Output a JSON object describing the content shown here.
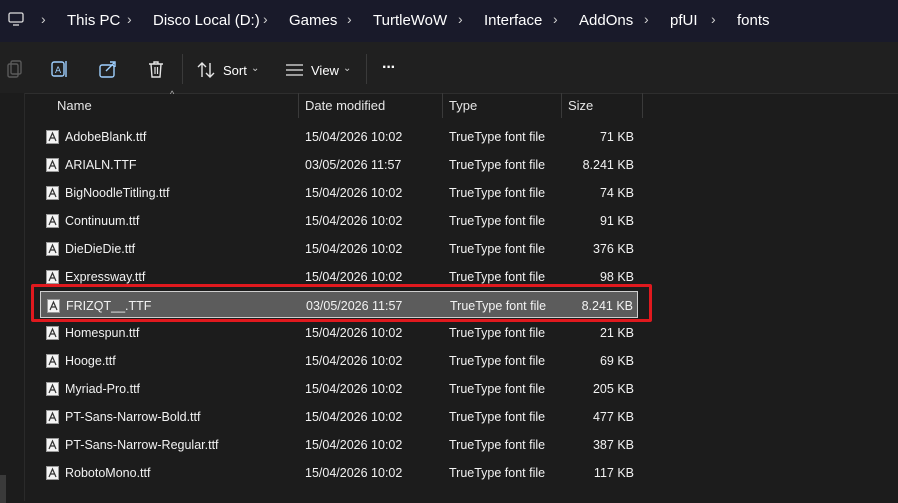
{
  "breadcrumb": [
    "This PC",
    "Disco Local (D:)",
    "Games",
    "TurtleWoW",
    "Interface",
    "AddOns",
    "pfUI",
    "fonts"
  ],
  "toolbar": {
    "sort_label": "Sort",
    "view_label": "View",
    "more_label": "···"
  },
  "columns": {
    "name": "Name",
    "date": "Date modified",
    "type": "Type",
    "size": "Size"
  },
  "files": [
    {
      "name": "AdobeBlank.ttf",
      "date": "15/04/2026 10:02",
      "type": "TrueType font file",
      "size": "71 KB"
    },
    {
      "name": "ARIALN.TTF",
      "date": "03/05/2026 11:57",
      "type": "TrueType font file",
      "size": "8.241 KB"
    },
    {
      "name": "BigNoodleTitling.ttf",
      "date": "15/04/2026 10:02",
      "type": "TrueType font file",
      "size": "74 KB"
    },
    {
      "name": "Continuum.ttf",
      "date": "15/04/2026 10:02",
      "type": "TrueType font file",
      "size": "91 KB"
    },
    {
      "name": "DieDieDie.ttf",
      "date": "15/04/2026 10:02",
      "type": "TrueType font file",
      "size": "376 KB"
    },
    {
      "name": "Expressway.ttf",
      "date": "15/04/2026 10:02",
      "type": "TrueType font file",
      "size": "98 KB"
    },
    {
      "name": "FRIZQT__.TTF",
      "date": "03/05/2026 11:57",
      "type": "TrueType font file",
      "size": "8.241 KB",
      "selected": true
    },
    {
      "name": "Homespun.ttf",
      "date": "15/04/2026 10:02",
      "type": "TrueType font file",
      "size": "21 KB"
    },
    {
      "name": "Hooge.ttf",
      "date": "15/04/2026 10:02",
      "type": "TrueType font file",
      "size": "69 KB"
    },
    {
      "name": "Myriad-Pro.ttf",
      "date": "15/04/2026 10:02",
      "type": "TrueType font file",
      "size": "205 KB"
    },
    {
      "name": "PT-Sans-Narrow-Bold.ttf",
      "date": "15/04/2026 10:02",
      "type": "TrueType font file",
      "size": "477 KB"
    },
    {
      "name": "PT-Sans-Narrow-Regular.ttf",
      "date": "15/04/2026 10:02",
      "type": "TrueType font file",
      "size": "387 KB"
    },
    {
      "name": "RobotoMono.ttf",
      "date": "15/04/2026 10:02",
      "type": "TrueType font file",
      "size": "117 KB"
    }
  ],
  "icons": {
    "address": "this-pc-icon",
    "copy": "copy-icon",
    "rename": "rename-icon",
    "share": "share-icon",
    "delete": "delete-icon",
    "sort": "sort-icon",
    "view": "view-icon",
    "file": "font-file-icon"
  },
  "colors": {
    "address_bg": "#191a2a",
    "toolbar_bg": "#202020",
    "list_bg": "#1c1c1c",
    "selected_bg": "#5c5c5c",
    "highlight_border": "#e0191e"
  }
}
